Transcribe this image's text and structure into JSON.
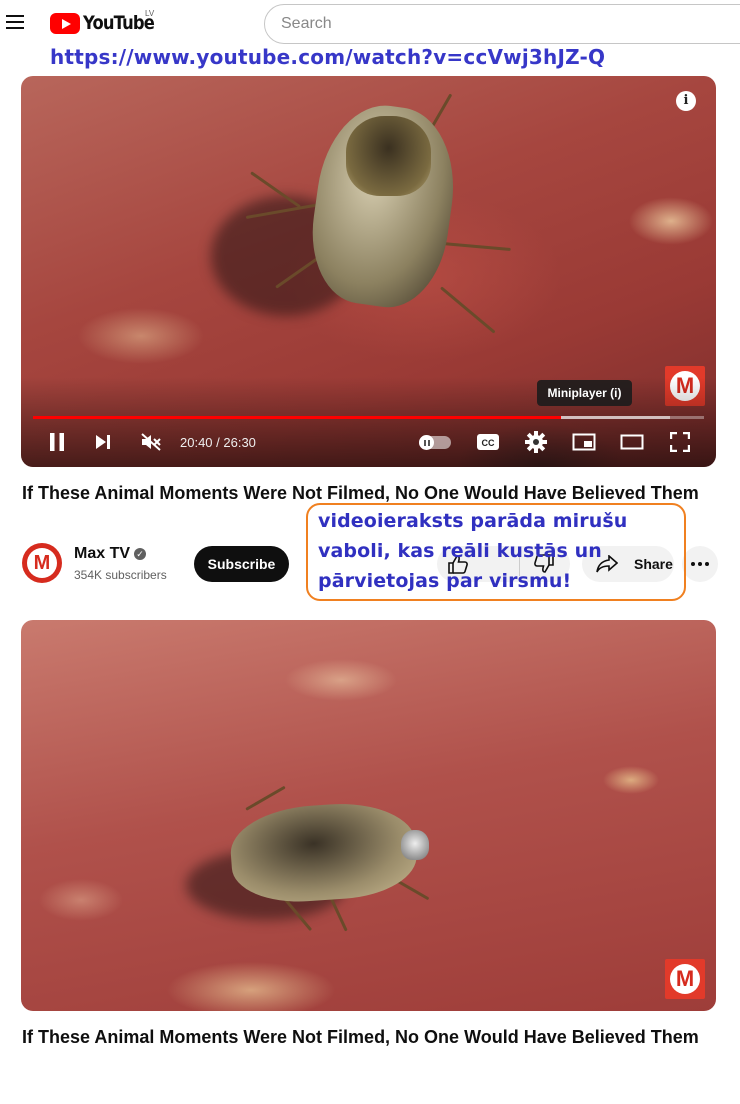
{
  "header": {
    "logo_text": "YouTube",
    "region": "LV",
    "search_placeholder": "Search"
  },
  "overlay_url": "https://www.youtube.com/watch?v=ccVwj3hJZ-Q",
  "player": {
    "tooltip": "Miniplayer (i)",
    "info_glyph": "i",
    "time_text": "20:40 / 26:30",
    "progress_played": 0.787,
    "progress_buffered": 0.95,
    "muted": true,
    "autoplay_on": false
  },
  "video": {
    "title": "If These Animal Moments Were Not Filmed, No One Would Have Believed Them",
    "channel_name": "Max TV",
    "subscribers": "354K subscribers",
    "subscribe_label": "Subscribe",
    "share_label": "Share",
    "channel_logo_letter": "M"
  },
  "annotation_text": "videoieraksts parāda mirušu vaboli, kas reāli kustās un pārvietojas par virsmu!",
  "second_frame": {
    "title": "If These Animal Moments Were Not Filmed, No One Would Have Believed Them",
    "logo_letter": "M"
  },
  "colors": {
    "brand_red": "#ff0000",
    "annotation_border": "#f08020",
    "annotation_text": "#3030c0",
    "url_text": "#3737c8"
  },
  "icons": [
    "menu-icon",
    "youtube-logo-icon",
    "info-icon",
    "pause-icon",
    "next-icon",
    "mute-icon",
    "autoplay-toggle-icon",
    "captions-icon",
    "settings-icon",
    "miniplayer-icon",
    "theater-icon",
    "fullscreen-icon",
    "like-icon",
    "dislike-icon",
    "share-icon",
    "more-icon",
    "verified-icon"
  ]
}
